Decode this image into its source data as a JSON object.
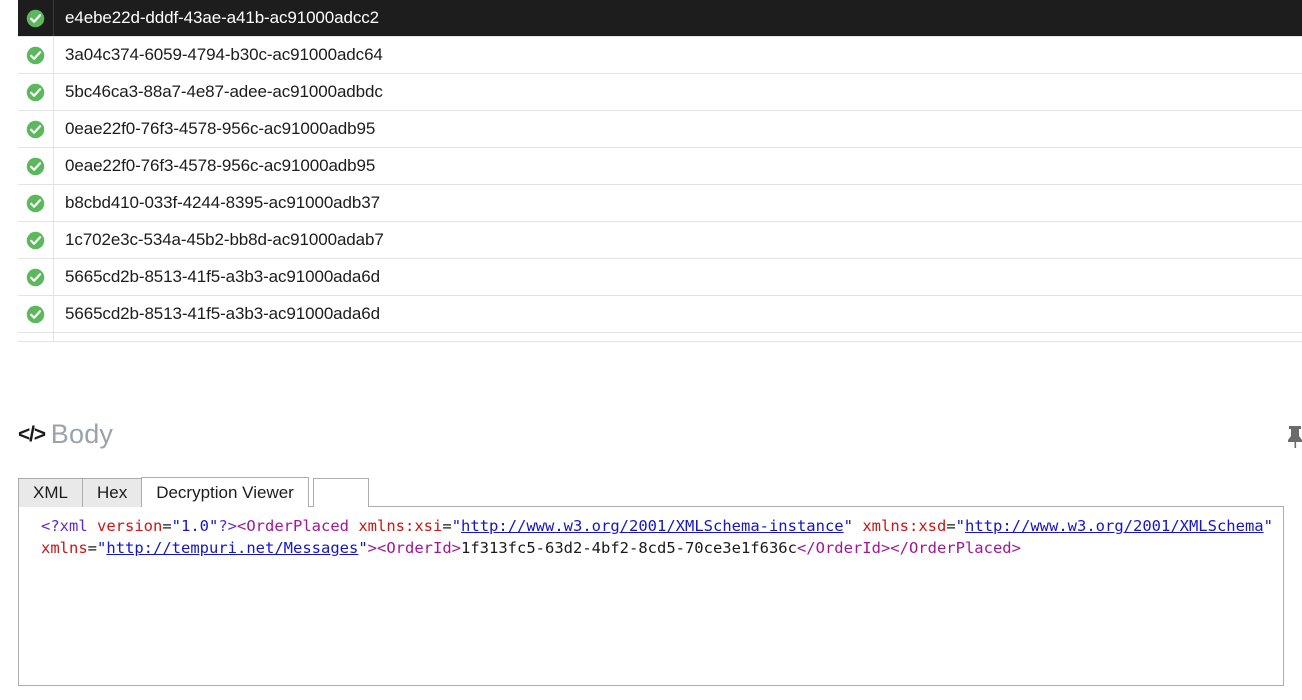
{
  "message_list": {
    "rows": [
      {
        "id": "e4ebe22d-dddf-43ae-a41b-ac91000adcc2",
        "status": "success",
        "selected": true
      },
      {
        "id": "3a04c374-6059-4794-b30c-ac91000adc64",
        "status": "success",
        "selected": false
      },
      {
        "id": "5bc46ca3-88a7-4e87-adee-ac91000adbdc",
        "status": "success",
        "selected": false
      },
      {
        "id": "0eae22f0-76f3-4578-956c-ac91000adb95",
        "status": "success",
        "selected": false
      },
      {
        "id": "0eae22f0-76f3-4578-956c-ac91000adb95",
        "status": "success",
        "selected": false
      },
      {
        "id": "b8cbd410-033f-4244-8395-ac91000adb37",
        "status": "success",
        "selected": false
      },
      {
        "id": "1c702e3c-534a-45b2-bb8d-ac91000adab7",
        "status": "success",
        "selected": false
      },
      {
        "id": "5665cd2b-8513-41f5-a3b3-ac91000ada6d",
        "status": "success",
        "selected": false
      },
      {
        "id": "5665cd2b-8513-41f5-a3b3-ac91000ada6d",
        "status": "success",
        "selected": false
      },
      {
        "id": "",
        "status": "success",
        "selected": false
      }
    ],
    "status_icon": "check-circle-icon",
    "status_icon_color": "#5cb85c",
    "selected_row_bg": "#1d1d1d"
  },
  "body_section": {
    "icon": "code-brackets-icon",
    "icon_glyph": "</>",
    "title": "Body",
    "title_color": "#9aa3ab",
    "pin_icon": "pin-icon"
  },
  "tabs": {
    "items": [
      {
        "label": "XML",
        "active": false
      },
      {
        "label": "Hex",
        "active": false
      },
      {
        "label": "Decryption Viewer",
        "active": true
      }
    ]
  },
  "xml_content": {
    "raw": "<?xml version=\"1.0\"?><OrderPlaced xmlns:xsi=\"http://www.w3.org/2001/XMLSchema-instance\" xmlns:xsd=\"http://www.w3.org/2001/XMLSchema\" xmlns=\"http://tempuri.net/Messages\"><OrderId>1f313fc5-63d2-4bf2-8cd5-70ce3e1f636c</OrderId></OrderPlaced>",
    "tokens": [
      {
        "t": "<?xml ",
        "c": "decl"
      },
      {
        "t": "version",
        "c": "attr"
      },
      {
        "t": "=",
        "c": "punc"
      },
      {
        "t": "\"1.0\"",
        "c": "str"
      },
      {
        "t": "?>",
        "c": "decl"
      },
      {
        "t": "<OrderPlaced",
        "c": "tag"
      },
      {
        "t": " ",
        "c": "punc"
      },
      {
        "t": "xmlns:xsi",
        "c": "attr"
      },
      {
        "t": "=",
        "c": "punc"
      },
      {
        "t": "\"",
        "c": "str"
      },
      {
        "t": "http://www.w3.org/2001/XMLSchema-instance",
        "c": "link"
      },
      {
        "t": "\"",
        "c": "str"
      },
      {
        "t": " ",
        "c": "punc"
      },
      {
        "t": "xmlns:xsd",
        "c": "attr"
      },
      {
        "t": "=",
        "c": "punc"
      },
      {
        "t": "\"",
        "c": "str"
      },
      {
        "t": "http://www.w3.org/2001/XMLSchema",
        "c": "link"
      },
      {
        "t": "\"",
        "c": "str"
      },
      {
        "t": " ",
        "c": "punc"
      },
      {
        "t": "xmlns",
        "c": "attr"
      },
      {
        "t": "=",
        "c": "punc"
      },
      {
        "t": "\"",
        "c": "str"
      },
      {
        "t": "http://tempuri.net/Messages",
        "c": "link"
      },
      {
        "t": "\"",
        "c": "str"
      },
      {
        "t": ">",
        "c": "tag"
      },
      {
        "t": "<OrderId>",
        "c": "tag"
      },
      {
        "t": "1f313fc5-63d2-4bf2-8cd5-70ce3e1f636c",
        "c": "text"
      },
      {
        "t": "</OrderId>",
        "c": "tag"
      },
      {
        "t": "</OrderPlaced>",
        "c": "tag"
      }
    ],
    "order_id": "1f313fc5-63d2-4bf2-8cd5-70ce3e1f636c",
    "root_element": "OrderPlaced",
    "xml_version": "1.0"
  }
}
